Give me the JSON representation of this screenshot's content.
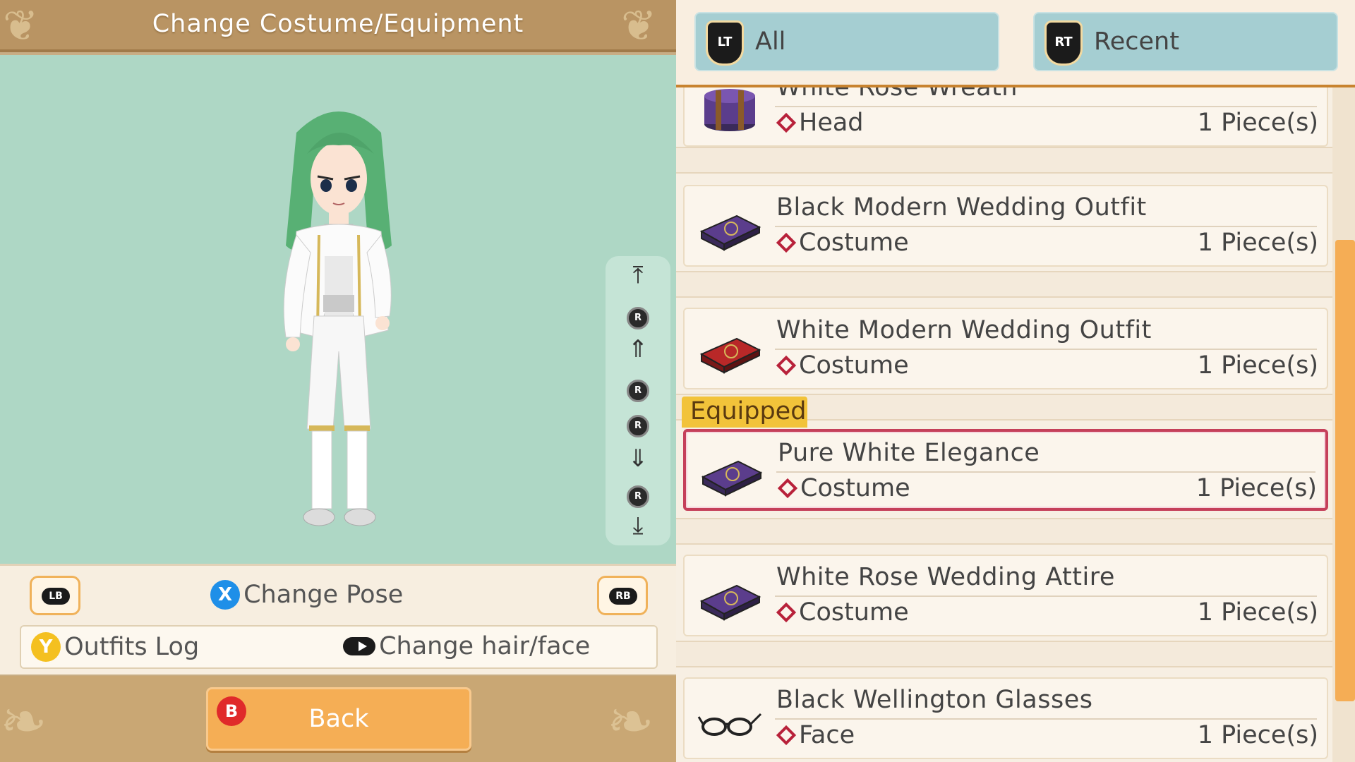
{
  "header": {
    "title": "Change Costume/Equipment"
  },
  "scroll_controls": {
    "r_label": "R"
  },
  "pose_bar": {
    "lb_label": "LB",
    "rb_label": "RB",
    "x_button": "X",
    "change_pose_label": "Change Pose",
    "y_button": "Y",
    "outfits_log_label": "Outfits Log",
    "change_hair_face_label": "Change hair/face"
  },
  "back_button": {
    "b_button": "B",
    "label": "Back"
  },
  "tabs": [
    {
      "trigger": "LT",
      "label": "All",
      "selected": true
    },
    {
      "trigger": "RT",
      "label": "Recent",
      "selected": false
    }
  ],
  "equipped_label": "Equipped",
  "items": [
    {
      "name": "White Rose Wreath",
      "category": "Head",
      "quantity": "1 Piece(s)",
      "icon": "purple-hatbox-icon",
      "equipped": false
    },
    {
      "name": "Black Modern Wedding Outfit",
      "category": "Costume",
      "quantity": "1 Piece(s)",
      "icon": "purple-costume-case-icon",
      "equipped": false
    },
    {
      "name": "White Modern Wedding Outfit",
      "category": "Costume",
      "quantity": "1 Piece(s)",
      "icon": "red-costume-case-icon",
      "equipped": false
    },
    {
      "name": "Pure White Elegance",
      "category": "Costume",
      "quantity": "1 Piece(s)",
      "icon": "purple-costume-case-icon",
      "equipped": true
    },
    {
      "name": "White Rose Wedding Attire",
      "category": "Costume",
      "quantity": "1 Piece(s)",
      "icon": "purple-costume-case-icon",
      "equipped": false
    },
    {
      "name": "Black Wellington Glasses",
      "category": "Face",
      "quantity": "1 Piece(s)",
      "icon": "glasses-icon",
      "equipped": false
    }
  ],
  "colors": {
    "viewport_bg": "#aed7c5",
    "tab_bg": "#a5ced2",
    "accent_orange": "#f5ad55",
    "equipped_border": "#c5405a",
    "equipped_tag": "#f2c33a",
    "category_diamond": "#b8213a",
    "hair_green": "#58b074"
  }
}
